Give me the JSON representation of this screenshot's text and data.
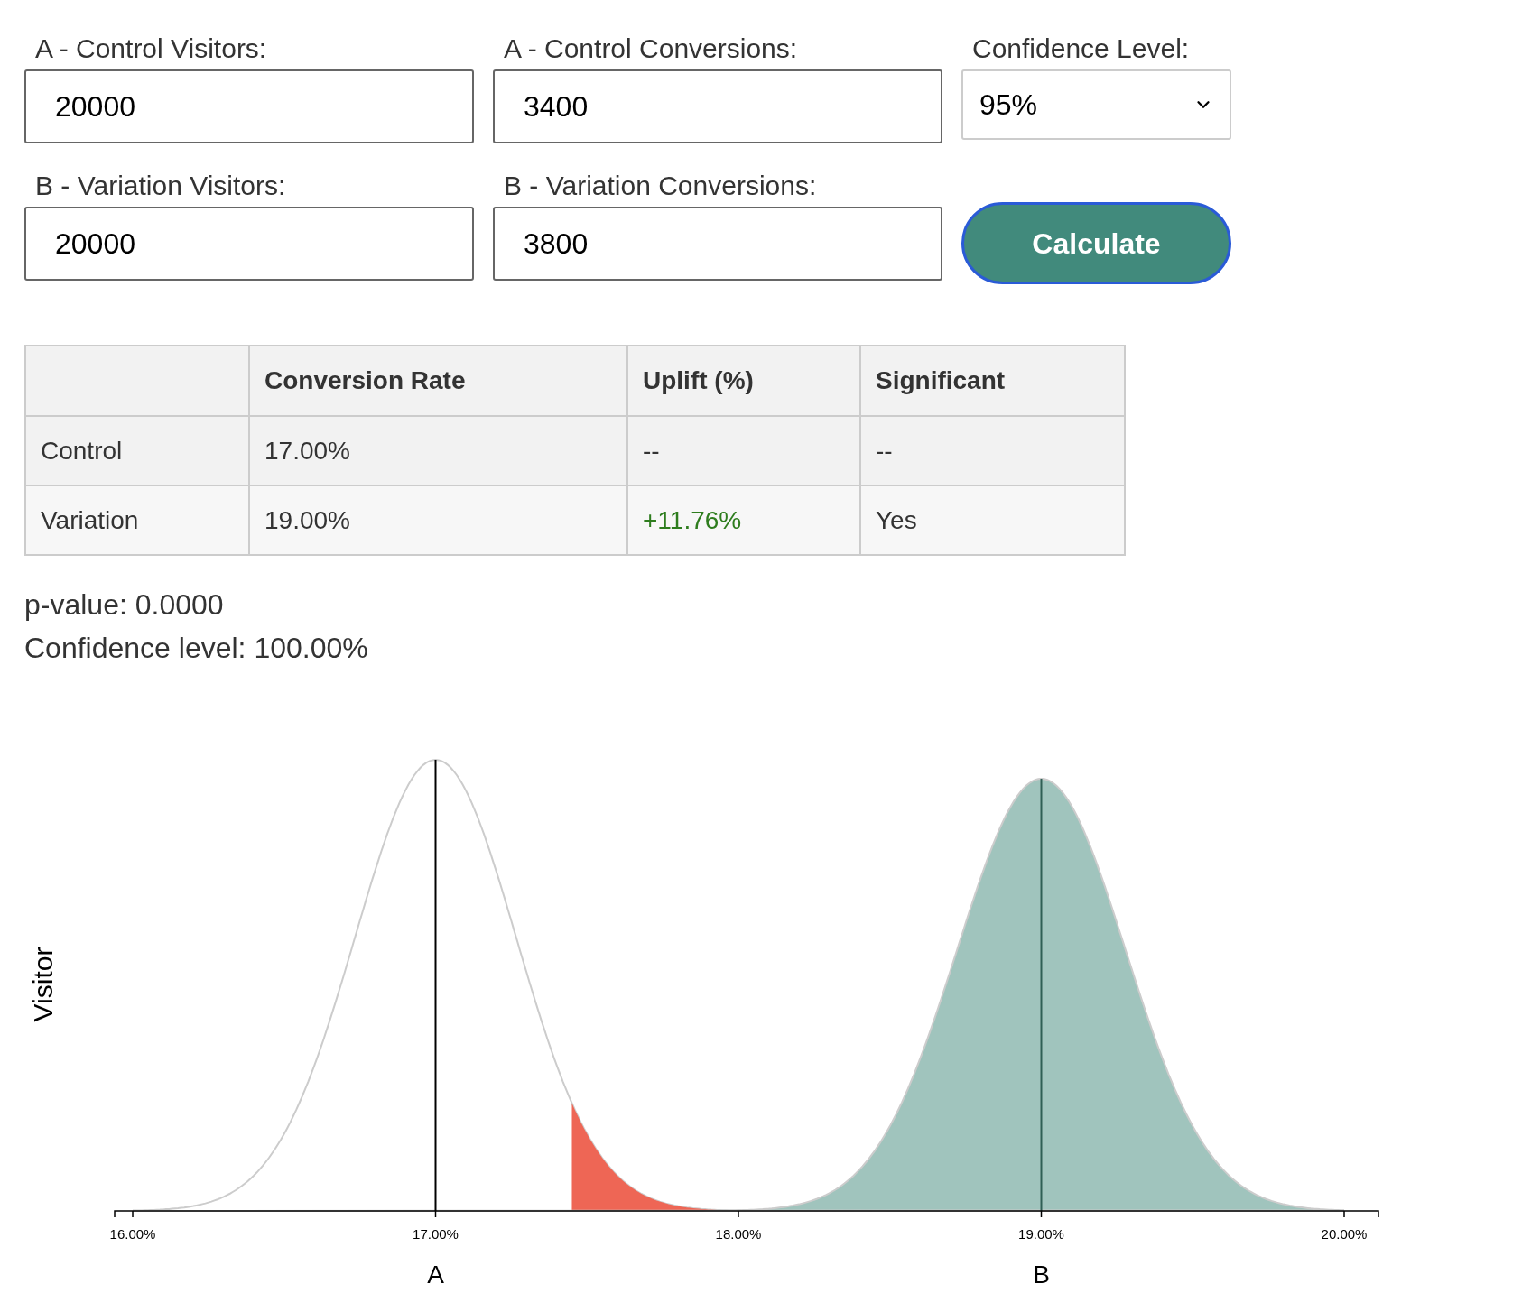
{
  "fields": [
    {
      "label": "A - Control Visitors:",
      "value": "20000"
    },
    {
      "label": "A - Control Conversions:",
      "value": "3400"
    },
    {
      "label": "B - Variation Visitors:",
      "value": "20000"
    },
    {
      "label": "B - Variation Conversions:",
      "value": "3800"
    }
  ],
  "confidence": {
    "label": "Confidence Level:",
    "value": "95%"
  },
  "calculate_button": "Calculate",
  "table": {
    "columns": [
      "Conversion Rate",
      "Uplift (%)",
      "Significant"
    ],
    "rows": [
      {
        "label": "Control",
        "cells": [
          "17.00%",
          "--",
          "--"
        ],
        "uplift_positive": false
      },
      {
        "label": "Variation",
        "cells": [
          "19.00%",
          "+11.76%",
          "Yes"
        ],
        "uplift_positive": true
      }
    ]
  },
  "stats": [
    "p-value: 0.0000",
    "Confidence level: 100.00%"
  ],
  "chart": {
    "ylabel": "Visitor",
    "xticks": [
      "16.00%",
      "17.00%",
      "18.00%",
      "19.00%",
      "20.00%"
    ],
    "group_labels": [
      "A",
      "B"
    ]
  }
}
